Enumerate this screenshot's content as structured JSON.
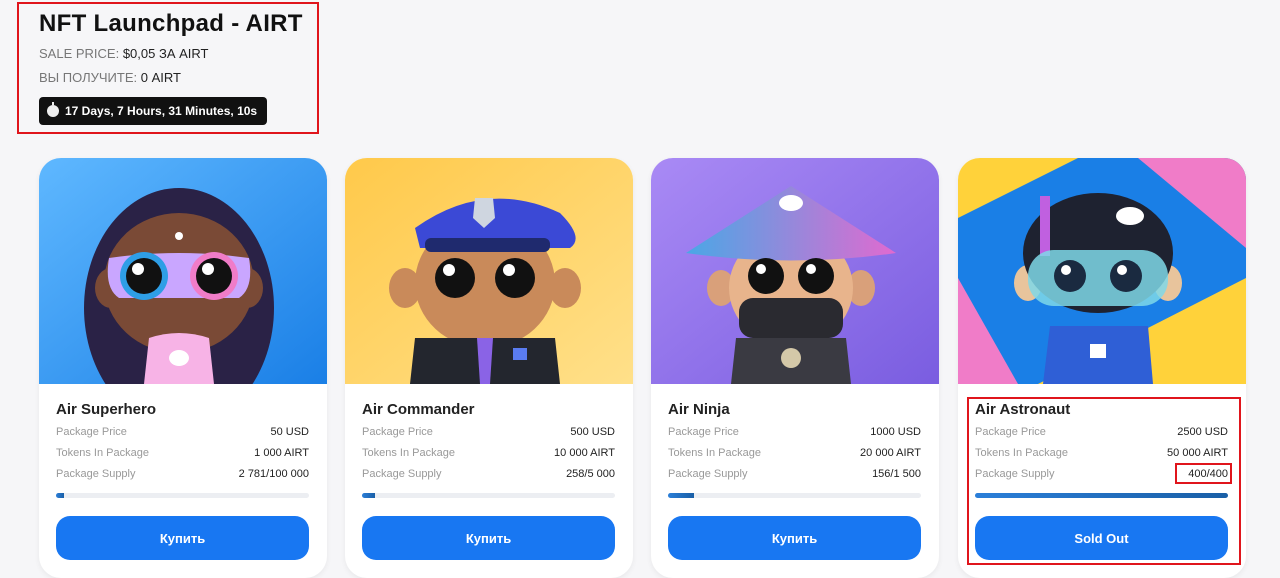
{
  "header": {
    "title": "NFT Launchpad - AIRT",
    "sale_price_label": "SALE PRICE:",
    "sale_price_value": "$0,05 ЗА AIRT",
    "receive_label": "ВЫ ПОЛУЧИТЕ:",
    "receive_value": "0 AIRT",
    "timer": "17 Days, 7 Hours, 31 Minutes, 10s",
    "timer_icon": "stopwatch-icon"
  },
  "labels": {
    "price": "Package Price",
    "tokens": "Tokens In Package",
    "supply": "Package Supply"
  },
  "cards": [
    {
      "name": "Air Superhero",
      "price": "50 USD",
      "tokens": "1 000 AIRT",
      "supply": "2 781/100 000",
      "progress": 0.028,
      "button": "Купить"
    },
    {
      "name": "Air Commander",
      "price": "500 USD",
      "tokens": "10 000 AIRT",
      "supply": "258/5 000",
      "progress": 0.052,
      "button": "Купить"
    },
    {
      "name": "Air Ninja",
      "price": "1000 USD",
      "tokens": "20 000 AIRT",
      "supply": "156/1 500",
      "progress": 0.104,
      "button": "Купить"
    },
    {
      "name": "Air Astronaut",
      "price": "2500 USD",
      "tokens": "50 000 AIRT",
      "supply": "400/400",
      "progress": 1.0,
      "button": "Sold Out"
    }
  ],
  "colors": {
    "accent": "#1877f2",
    "highlight": "#e0151c",
    "progress": "#2b7fd9"
  }
}
